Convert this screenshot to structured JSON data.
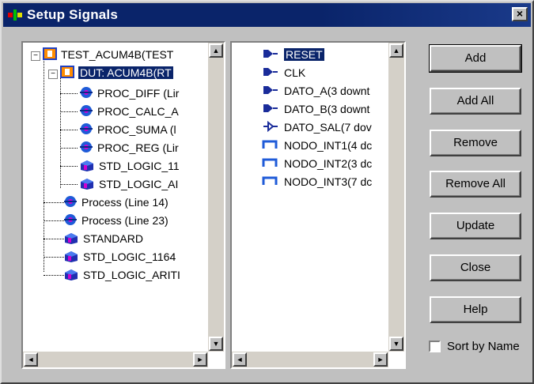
{
  "window": {
    "title": "Setup Signals",
    "close": "×"
  },
  "tree": {
    "items": [
      {
        "label": "TEST_ACUM4B(TEST",
        "expander": "−",
        "icon": "entity-icon"
      },
      {
        "label": "DUT: ACUM4B(RT",
        "expander": "−",
        "icon": "entity-icon"
      },
      {
        "label": "PROC_DIFF (Lir",
        "icon": "process-icon"
      },
      {
        "label": "PROC_CALC_A",
        "icon": "process-icon"
      },
      {
        "label": "PROC_SUMA (l",
        "icon": "process-icon"
      },
      {
        "label": "PROC_REG (Lir",
        "icon": "process-icon"
      },
      {
        "label": "STD_LOGIC_11",
        "icon": "package-icon"
      },
      {
        "label": "STD_LOGIC_AI",
        "icon": "package-icon"
      },
      {
        "label": "Process (Line 14)",
        "icon": "process-icon"
      },
      {
        "label": "Process (Line 23)",
        "icon": "process-icon"
      },
      {
        "label": "STANDARD",
        "icon": "package-icon"
      },
      {
        "label": "STD_LOGIC_1164",
        "icon": "package-icon"
      },
      {
        "label": "STD_LOGIC_ARITI",
        "icon": "package-icon"
      }
    ]
  },
  "signals": {
    "items": [
      {
        "label": "RESET",
        "icon": "input-port-icon"
      },
      {
        "label": "CLK",
        "icon": "input-port-icon"
      },
      {
        "label": "DATO_A(3 downt",
        "icon": "input-port-icon"
      },
      {
        "label": "DATO_B(3 downt",
        "icon": "input-port-icon"
      },
      {
        "label": "DATO_SAL(7 dov",
        "icon": "output-port-icon"
      },
      {
        "label": "NODO_INT1(4 dc",
        "icon": "internal-signal-icon"
      },
      {
        "label": "NODO_INT2(3 dc",
        "icon": "internal-signal-icon"
      },
      {
        "label": "NODO_INT3(7 dc",
        "icon": "internal-signal-icon"
      }
    ]
  },
  "buttons": {
    "add": "Add",
    "add_all": "Add All",
    "remove": "Remove",
    "remove_all": "Remove All",
    "update": "Update",
    "close": "Close",
    "help": "Help"
  },
  "sort_by_name": {
    "label": "Sort by Name",
    "checked": false
  },
  "scroll": {
    "up": "▲",
    "down": "▼",
    "left": "◄",
    "right": "►"
  },
  "colors": {
    "titlebar": "#0a246a",
    "selection": "#0a246a",
    "process_blue": "#1f5bd8",
    "process_magenta": "#d000d0",
    "port_blue": "#1a2c9a"
  }
}
